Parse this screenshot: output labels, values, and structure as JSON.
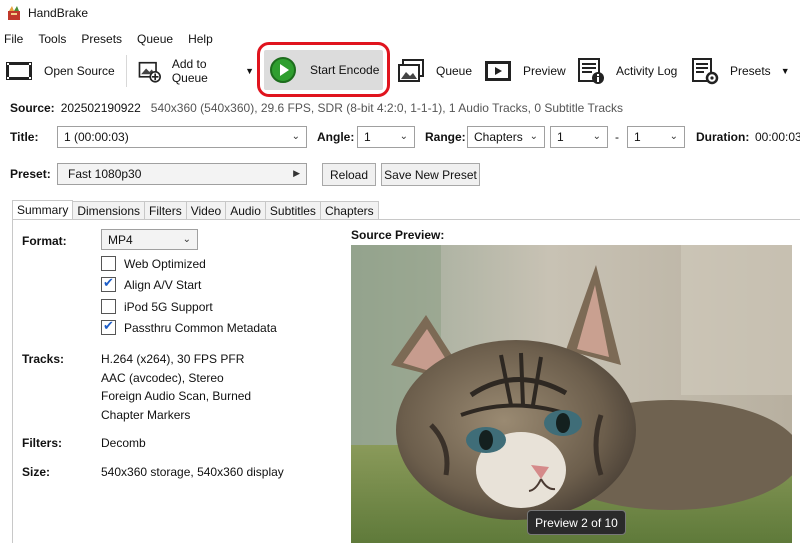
{
  "app": {
    "title": "HandBrake"
  },
  "menu": [
    "File",
    "Tools",
    "Presets",
    "Queue",
    "Help"
  ],
  "toolbar": {
    "open_source": "Open Source",
    "add_to_queue": "Add to Queue",
    "start_encode": "Start Encode",
    "queue": "Queue",
    "preview": "Preview",
    "activity_log": "Activity Log",
    "presets": "Presets"
  },
  "source": {
    "label": "Source:",
    "name": "202502190922",
    "details": "540x360 (540x360), 29.6 FPS, SDR (8-bit 4:2:0, 1-1-1), 1 Audio Tracks, 0 Subtitle Tracks"
  },
  "title_row": {
    "title_label": "Title:",
    "title_value": "1 (00:00:03)",
    "angle_label": "Angle:",
    "angle_value": "1",
    "range_label": "Range:",
    "range_type": "Chapters",
    "range_start": "1",
    "range_dash": "-",
    "range_end": "1",
    "duration_label": "Duration:",
    "duration_value": "00:00:03"
  },
  "preset_row": {
    "label": "Preset:",
    "value": "Fast 1080p30",
    "reload": "Reload",
    "save_new": "Save New Preset"
  },
  "tabs": [
    "Summary",
    "Dimensions",
    "Filters",
    "Video",
    "Audio",
    "Subtitles",
    "Chapters"
  ],
  "summary": {
    "format_label": "Format:",
    "format_value": "MP4",
    "options": [
      {
        "label": "Web Optimized",
        "checked": false
      },
      {
        "label": "Align A/V Start",
        "checked": true
      },
      {
        "label": "iPod 5G Support",
        "checked": false
      },
      {
        "label": "Passthru Common Metadata",
        "checked": true
      }
    ],
    "tracks_label": "Tracks:",
    "tracks": [
      "H.264 (x264), 30 FPS PFR",
      "AAC (avcodec), Stereo",
      "Foreign Audio Scan, Burned",
      "Chapter Markers"
    ],
    "filters_label": "Filters:",
    "filters_value": "Decomb",
    "size_label": "Size:",
    "size_value": "540x360 storage, 540x360 display",
    "source_preview_label": "Source Preview:",
    "preview_badge": "Preview 2 of 10"
  },
  "colors": {
    "highlight": "#e0141e",
    "play_green": "#2f9e2f",
    "check_blue": "#1e5ec8"
  }
}
